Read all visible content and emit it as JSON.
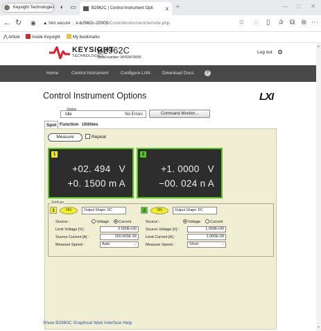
{
  "browser": {
    "profile_label": "Keysight Technologies",
    "tab_title": "B2962C | Control Instrument Opti",
    "tab_close": "x",
    "new_tab": "+",
    "win_min": "—",
    "win_max": "□",
    "win_close": "✕",
    "url_warning": "▲ Not secure",
    "url_host": "k-b2962c-20005",
    "url_path": "/ControlInstrument/remote.php",
    "bookmarks": [
      {
        "label": "Article"
      },
      {
        "label": "Inside Keysight"
      },
      {
        "label": "My bookmarks"
      }
    ],
    "colors": {
      "bm_inside": "#cc2a2a",
      "bm_folder": "#f0c040"
    }
  },
  "header": {
    "brand": "KEYSIGHT",
    "brand_sub": "TECHNOLOGIES",
    "model": "B2962C",
    "serial": "Serial number: MY63470005",
    "logout": "Log out",
    "gear": "⚙",
    "brand_color": "#e4192a"
  },
  "nav": {
    "home": "Home",
    "control": "Control Instrument",
    "lan": "Configure LAN",
    "docs": "Download Docs",
    "help": "?"
  },
  "page": {
    "title": "Control Instrument Options",
    "lxi": "LXI",
    "status_label": "Status",
    "status_value": "Idle",
    "error_value": "No Errors",
    "command_monitor": "Command Monitor...",
    "tabs": [
      "Spot",
      "Function",
      "Utilities"
    ],
    "measure": "Measure",
    "repeat": "Repeat"
  },
  "channels": [
    {
      "num": "1",
      "reading1": "+02. 494   V",
      "reading2": "+0. 1500 m A",
      "on": "ON",
      "shape": "Output Shape: DC",
      "source_label": "Source :",
      "source_opts": [
        "Voltage",
        "Current"
      ],
      "source_selected": "Current",
      "limit_label": "Limit Voltage [V] :",
      "limit_value": "2.500E+00",
      "src_label": "Source Current [A] :",
      "src_value": "150.000E-06",
      "speed_label": "Measure Speed :",
      "speed_value": "Auto",
      "tag_color": "#f2ef16"
    },
    {
      "num": "2",
      "reading1": "+1. 0000   V",
      "reading2": "−00. 024 n A",
      "on": "ON",
      "shape": "Output Shape: DC",
      "source_label": "Source :",
      "source_opts": [
        "Voltage",
        "Current"
      ],
      "source_selected": "Voltage",
      "limit_label": "Source Voltage [V] :",
      "limit_value": "1.000E+00",
      "src_label": "Limit Current [A] :",
      "src_value": "1.000E-09",
      "speed_label": "Measure Speed :",
      "speed_value": "Short",
      "tag_color": "#55c820"
    }
  ],
  "settings_label": "Settings",
  "footer_link": "Show B2960C Graphical Web Interface Help"
}
